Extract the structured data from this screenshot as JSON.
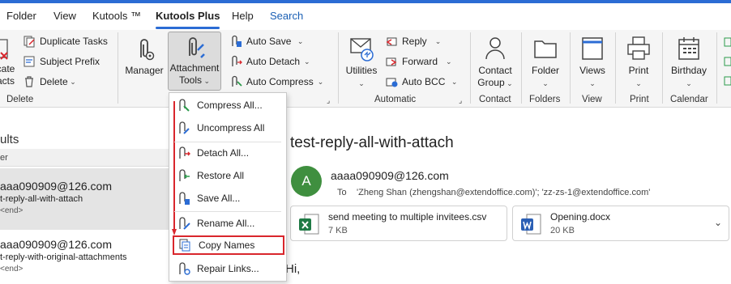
{
  "tabs": [
    "Folder",
    "View",
    "Kutools ™",
    "Kutools Plus",
    "Help",
    "Search"
  ],
  "ribbon": {
    "delete_group": {
      "cut_label_1": "cate",
      "cut_label_2": "acts",
      "items": [
        "Duplicate Tasks",
        "Subject Prefix",
        "Delete"
      ],
      "label": "Delete"
    },
    "manager": "Manager",
    "attachment_tools": [
      "Attachment",
      "Tools"
    ],
    "auto_items": [
      "Auto Save",
      "Auto Detach",
      "Auto Compress"
    ],
    "utilities": "Utilities",
    "automatic_items": [
      "Reply",
      "Forward",
      "Auto BCC"
    ],
    "automatic_label": "Automatic",
    "contact_group": [
      "Contact",
      "Group"
    ],
    "contact_label": "Contact",
    "folder": "Folder",
    "folders_label": "Folders",
    "views": "Views",
    "view_label": "View",
    "print": "Print",
    "print_label": "Print",
    "birthday": "Birthday",
    "calendar_label": "Calendar"
  },
  "dropdown": {
    "items": [
      "Compress All...",
      "Uncompress All",
      "Detach All...",
      "Restore All",
      "Save All...",
      "Rename All...",
      "Copy Names",
      "Repair Links..."
    ],
    "highlighted": "Copy Names",
    "highlight_color": "#d9262c"
  },
  "mail_list": {
    "header_1": "ults",
    "header_2": "er",
    "items": [
      {
        "from": "aaa090909@126.com",
        "subject": "t-reply-all-with-attach",
        "preview": "<end>"
      },
      {
        "from": "aaa090909@126.com",
        "subject": "t-reply-with-original-attachments",
        "preview": "<end>"
      }
    ]
  },
  "reading": {
    "subject": "test-reply-all-with-attach",
    "avatar_letter": "A",
    "sender": "aaaa090909@126.com",
    "to_label": "To",
    "to_value": "'Zheng Shan (zhengshan@extendoffice.com)'; 'zz-zs-1@extendoffice.com'",
    "attachments": [
      {
        "name": "send meeting to multiple invitees.csv",
        "size": "7 KB",
        "type": "xlsx"
      },
      {
        "name": "Opening.docx",
        "size": "20 KB",
        "type": "docx"
      }
    ],
    "body_start": "Hi,"
  },
  "colors": {
    "accent": "#2b6cd4",
    "avatar": "#3f8f3f",
    "arrow": "#d9262c"
  }
}
